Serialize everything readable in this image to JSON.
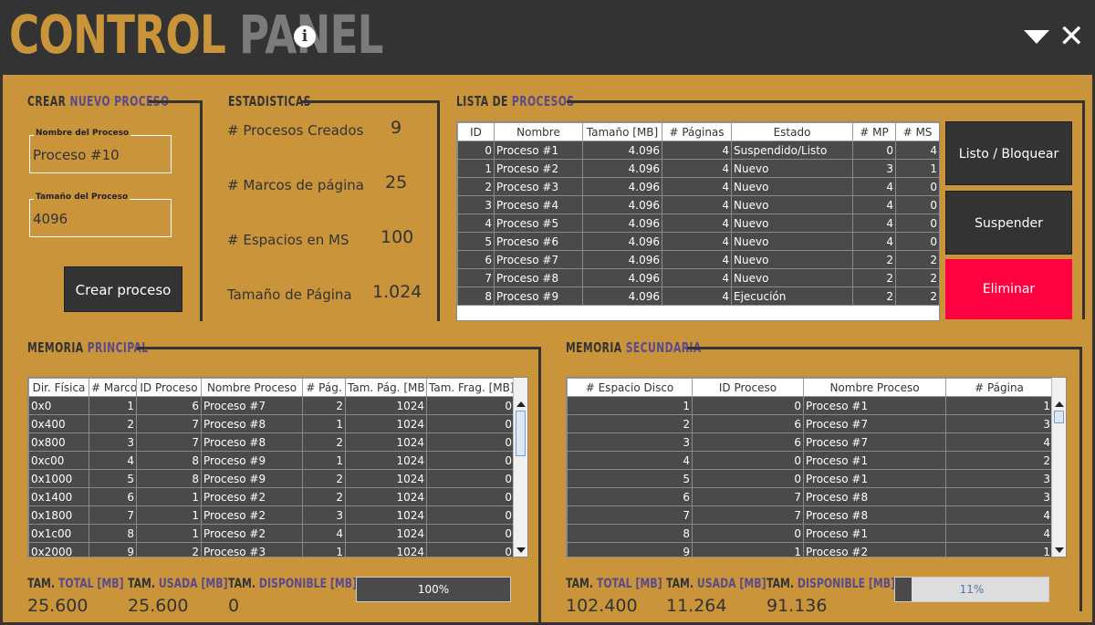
{
  "header": {
    "title_a": "CONTROL",
    "title_b": "PANEL",
    "info_icon": "info-icon",
    "minimize_icon": "dropdown-triangle-icon",
    "close_icon": "close-icon"
  },
  "crear": {
    "title_a": "CREAR",
    "title_b": "NUEVO PROCESO",
    "name_label": "Nombre del Proceso",
    "name_value": "Proceso #10",
    "size_label": "Tamaño del Proceso",
    "size_value": "4096",
    "button": "Crear proceso"
  },
  "stats": {
    "title": "ESTADISTICAS",
    "items": [
      {
        "label": "# Procesos Creados",
        "value": "9"
      },
      {
        "label": "# Marcos de página",
        "value": "25"
      },
      {
        "label": "# Espacios en MS",
        "value": "100"
      },
      {
        "label": "Tamaño de Página",
        "value": "1.024"
      }
    ]
  },
  "lista": {
    "title_a": "LISTA DE",
    "title_b": "PROCESOS",
    "headers": [
      "ID",
      "Nombre",
      "Tamaño [MB]",
      "# Páginas",
      "Estado",
      "# MP",
      "# MS"
    ],
    "rows": [
      [
        "0",
        "Proceso #1",
        "4.096",
        "4",
        "Suspendido/Listo",
        "0",
        "4"
      ],
      [
        "1",
        "Proceso #2",
        "4.096",
        "4",
        "Nuevo",
        "3",
        "1"
      ],
      [
        "2",
        "Proceso #3",
        "4.096",
        "4",
        "Nuevo",
        "4",
        "0"
      ],
      [
        "3",
        "Proceso #4",
        "4.096",
        "4",
        "Nuevo",
        "4",
        "0"
      ],
      [
        "4",
        "Proceso #5",
        "4.096",
        "4",
        "Nuevo",
        "4",
        "0"
      ],
      [
        "5",
        "Proceso #6",
        "4.096",
        "4",
        "Nuevo",
        "4",
        "0"
      ],
      [
        "6",
        "Proceso #7",
        "4.096",
        "4",
        "Nuevo",
        "2",
        "2"
      ],
      [
        "7",
        "Proceso #8",
        "4.096",
        "4",
        "Nuevo",
        "2",
        "2"
      ],
      [
        "8",
        "Proceso #9",
        "4.096",
        "4",
        "Ejecución",
        "2",
        "2"
      ]
    ],
    "btn_listo": "Listo / Bloquear",
    "btn_suspender": "Suspender",
    "btn_eliminar": "Eliminar"
  },
  "mp": {
    "title_a": "MEMORIA",
    "title_b": "PRINCIPAL",
    "headers": [
      "Dir. Física",
      "# Marco",
      "ID Proceso",
      "Nombre Proceso",
      "# Pág.",
      "Tam. Pág. [MB]",
      "Tam. Frag. [MB]"
    ],
    "rows": [
      [
        "0x0",
        "1",
        "6",
        "Proceso #7",
        "2",
        "1024",
        "0"
      ],
      [
        "0x400",
        "2",
        "7",
        "Proceso #8",
        "1",
        "1024",
        "0"
      ],
      [
        "0x800",
        "3",
        "7",
        "Proceso #8",
        "2",
        "1024",
        "0"
      ],
      [
        "0xc00",
        "4",
        "8",
        "Proceso #9",
        "1",
        "1024",
        "0"
      ],
      [
        "0x1000",
        "5",
        "8",
        "Proceso #9",
        "2",
        "1024",
        "0"
      ],
      [
        "0x1400",
        "6",
        "1",
        "Proceso #2",
        "2",
        "1024",
        "0"
      ],
      [
        "0x1800",
        "7",
        "1",
        "Proceso #2",
        "3",
        "1024",
        "0"
      ],
      [
        "0x1c00",
        "8",
        "1",
        "Proceso #2",
        "4",
        "1024",
        "0"
      ],
      [
        "0x2000",
        "9",
        "2",
        "Proceso #3",
        "1",
        "1024",
        "0"
      ]
    ],
    "total_a": "TAM.",
    "total_b": "TOTAL [MB]",
    "total_value": "25.600",
    "usada_a": "TAM.",
    "usada_b": "USADA [MB]",
    "usada_value": "25.600",
    "disp_a": "TAM.",
    "disp_b": "DISPONIBLE [MB]",
    "disp_value": "0",
    "progress_text": "100%",
    "progress_fraction": 1.0
  },
  "ms": {
    "title_a": "MEMORIA",
    "title_b": "SECUNDARIA",
    "headers": [
      "# Espacio Disco",
      "ID Proceso",
      "Nombre Proceso",
      "# Página"
    ],
    "rows": [
      [
        "1",
        "0",
        "Proceso #1",
        "1"
      ],
      [
        "2",
        "6",
        "Proceso #7",
        "3"
      ],
      [
        "3",
        "6",
        "Proceso #7",
        "4"
      ],
      [
        "4",
        "0",
        "Proceso #1",
        "2"
      ],
      [
        "5",
        "0",
        "Proceso #1",
        "3"
      ],
      [
        "6",
        "7",
        "Proceso #8",
        "3"
      ],
      [
        "7",
        "7",
        "Proceso #8",
        "4"
      ],
      [
        "8",
        "0",
        "Proceso #1",
        "4"
      ],
      [
        "9",
        "1",
        "Proceso #2",
        "1"
      ]
    ],
    "total_a": "TAM.",
    "total_b": "TOTAL [MB]",
    "total_value": "102.400",
    "usada_a": "TAM.",
    "usada_b": "USADA [MB]",
    "usada_value": "11.264",
    "disp_a": "TAM.",
    "disp_b": "DISPONIBLE [MB]",
    "disp_value": "91.136",
    "progress_text": "11%",
    "progress_fraction": 0.11
  },
  "colors": {
    "accent": "#C9943A",
    "dark": "#333333",
    "danger": "#FF0040",
    "highlight_text": "#5A4A8A"
  }
}
